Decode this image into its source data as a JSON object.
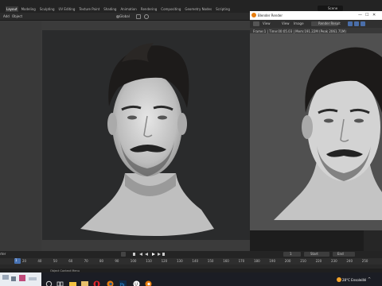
{
  "topbar": {
    "tabs": [
      "Layout",
      "Modeling",
      "Sculpting",
      "UV Editing",
      "Texture Paint",
      "Shading",
      "Animation",
      "Rendering",
      "Compositing",
      "Geometry Nodes",
      "Scripting"
    ],
    "active_tab": "Layout",
    "scene": "Scene"
  },
  "toolbar": {
    "add": "Add",
    "object": "Object",
    "orientation": "Global"
  },
  "render_window": {
    "title": "Blender Render",
    "menu_view": "View",
    "menu_view2": "View",
    "menu_image": "Image",
    "slot": "Render Result",
    "stats": "Frame:1 | Time:00:05.03 | Mem:191.22M (Peak 2061.71M)"
  },
  "timeline": {
    "label": "rter",
    "current_frame": "1",
    "frame_value": "1",
    "start_label": "Start",
    "start_value": "1",
    "end_label": "End",
    "end_value": "250",
    "ticks": [
      "20",
      "40",
      "50",
      "60",
      "70",
      "80",
      "90",
      "100",
      "110",
      "120",
      "130",
      "140",
      "150",
      "160",
      "170",
      "180",
      "190",
      "200",
      "210",
      "220",
      "230",
      "240",
      "250"
    ]
  },
  "statusbar": {
    "hint": "Object Context Menu"
  },
  "taskbar": {
    "temperature": "28°C",
    "weather": "Ensoleillé"
  },
  "colors": {
    "accent": "#4772b3",
    "blender_orange": "#e87d0d"
  }
}
